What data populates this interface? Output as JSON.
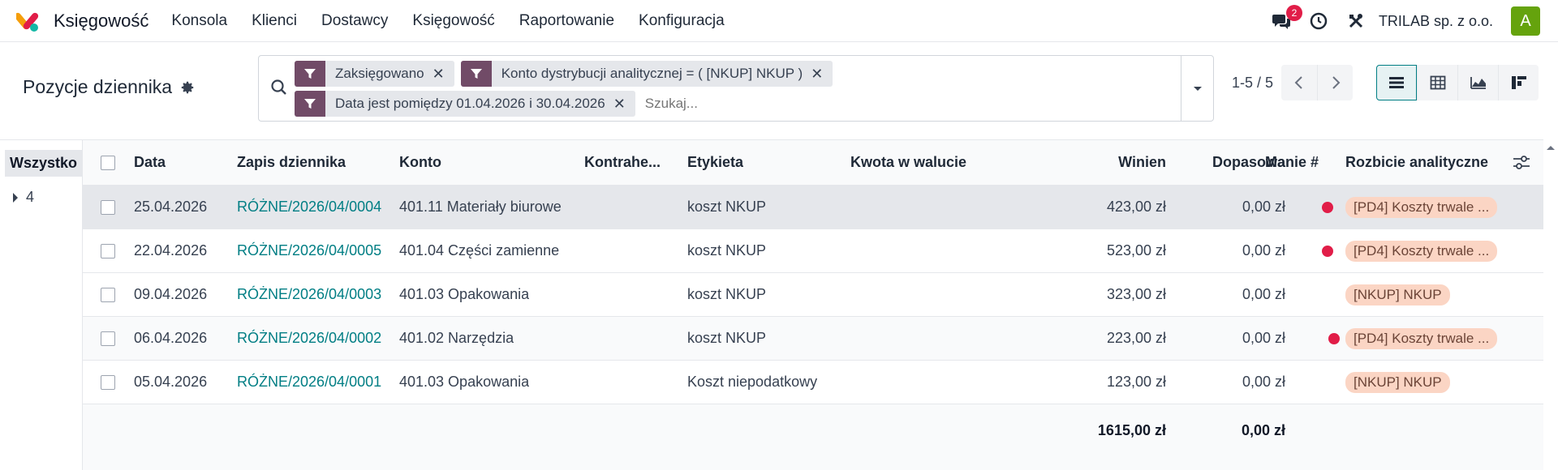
{
  "navbar": {
    "app_name": "Księgowość",
    "menu": [
      "Konsola",
      "Klienci",
      "Dostawcy",
      "Księgowość",
      "Raportowanie",
      "Konfiguracja"
    ],
    "messages_badge": "2",
    "company": "TRILAB sp. z o.o.",
    "avatar_letter": "A"
  },
  "control": {
    "title": "Pozycje dziennika",
    "facets": [
      "Zaksięgowano",
      "Konto dystrybucji analitycznej = ( [NKUP] NKUP )",
      "Data jest pomiędzy 01.04.2026 i 30.04.2026"
    ],
    "search_placeholder": "Szukaj...",
    "pager": "1-5 / 5"
  },
  "sidepanel": {
    "all_label": "Wszystko",
    "items": [
      "4"
    ]
  },
  "table": {
    "columns": [
      "Data",
      "Zapis dziennika",
      "Konto",
      "Kontrahe...",
      "Etykieta",
      "Kwota w walucie",
      "Winien",
      "Ma",
      "Dopasowanie #",
      "Rozbicie analityczne"
    ],
    "rows": [
      {
        "date": "25.04.2026",
        "entry": "RÓŻNE/2026/04/0004",
        "account": "401.11 Materiały biurowe",
        "partner": "",
        "label": "koszt NKUP",
        "amount_currency": "",
        "debit": "423,00 zł",
        "credit": "0,00 zł",
        "matching_dot": true,
        "analytic": "[PD4] Koszty trwale ..."
      },
      {
        "date": "22.04.2026",
        "entry": "RÓŻNE/2026/04/0005",
        "account": "401.04 Części zamienne",
        "partner": "",
        "label": "koszt NKUP",
        "amount_currency": "",
        "debit": "523,00 zł",
        "credit": "0,00 zł",
        "matching_dot": true,
        "analytic": "[PD4] Koszty trwale ..."
      },
      {
        "date": "09.04.2026",
        "entry": "RÓŻNE/2026/04/0003",
        "account": "401.03 Opakowania",
        "partner": "",
        "label": "koszt NKUP",
        "amount_currency": "",
        "debit": "323,00 zł",
        "credit": "0,00 zł",
        "matching_dot": false,
        "analytic": "[NKUP] NKUP"
      },
      {
        "date": "06.04.2026",
        "entry": "RÓŻNE/2026/04/0002",
        "account": "401.02 Narzędzia",
        "partner": "",
        "label": "koszt NKUP",
        "amount_currency": "",
        "debit": "223,00 zł",
        "credit": "0,00 zł",
        "matching_dot": true,
        "analytic": "[PD4] Koszty trwale ..."
      },
      {
        "date": "05.04.2026",
        "entry": "RÓŻNE/2026/04/0001",
        "account": "401.03 Opakowania",
        "partner": "",
        "label": "Koszt niepodatkowy",
        "amount_currency": "",
        "debit": "123,00 zł",
        "credit": "0,00 zł",
        "matching_dot": false,
        "analytic": "[NKUP] NKUP"
      }
    ],
    "totals": {
      "debit": "1615,00 zł",
      "credit": "0,00 zł"
    }
  },
  "colors": {
    "brand": "#714b67",
    "accent": "#017e84",
    "danger": "#e11d48",
    "tag_bg": "#fbd5c4"
  }
}
